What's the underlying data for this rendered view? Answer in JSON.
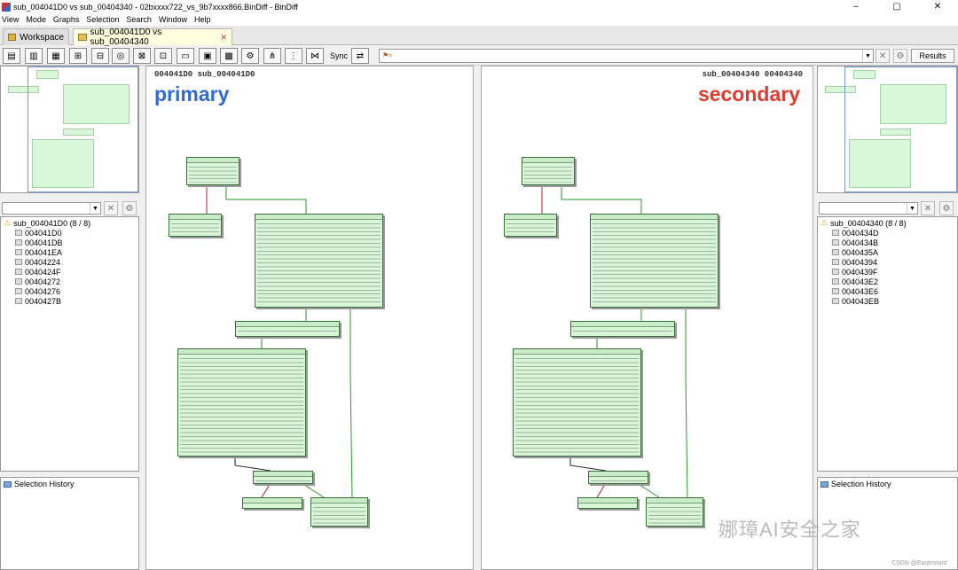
{
  "window": {
    "title": "sub_004041D0 vs sub_00404340 - 02bxxxx722_vs_9b7xxxx866.BinDiff - BinDiff",
    "minimize": "–",
    "maximize": "▢",
    "close": "✕"
  },
  "menu": [
    "View",
    "Mode",
    "Graphs",
    "Selection",
    "Search",
    "Window",
    "Help"
  ],
  "tabs": {
    "workspace": "Workspace",
    "diff": "sub_004041D0 vs sub_00404340",
    "close": "✕"
  },
  "toolbar": {
    "sync_label": "Sync",
    "results_label": "Results",
    "search_placeholder": ""
  },
  "primary": {
    "header": "004041D0 sub_004041D0",
    "label": "primary",
    "tree_root": "sub_004041D0 (8 / 8)",
    "nodes": [
      "004041D0",
      "004041DB",
      "004041EA",
      "00404224",
      "0040424F",
      "00404272",
      "00404276",
      "0040427B"
    ],
    "history_label": "Selection History"
  },
  "secondary": {
    "header": "sub_00404340 00404340",
    "label": "secondary",
    "tree_root": "sub_00404340 (8 / 8)",
    "nodes": [
      "0040434D",
      "0040434B",
      "0040435A",
      "00404394",
      "0040439F",
      "004043E2",
      "004043E6",
      "004043EB"
    ],
    "history_label": "Selection History"
  },
  "colors": {
    "primary": "#2e6bd6",
    "secondary": "#e23a2e",
    "block_fill": "#d8f5d8",
    "edge_green": "#2a9a2a",
    "edge_red": "#c02020"
  },
  "watermark": "娜璋AI安全之家",
  "csdn": "CSDN @Eastmount"
}
